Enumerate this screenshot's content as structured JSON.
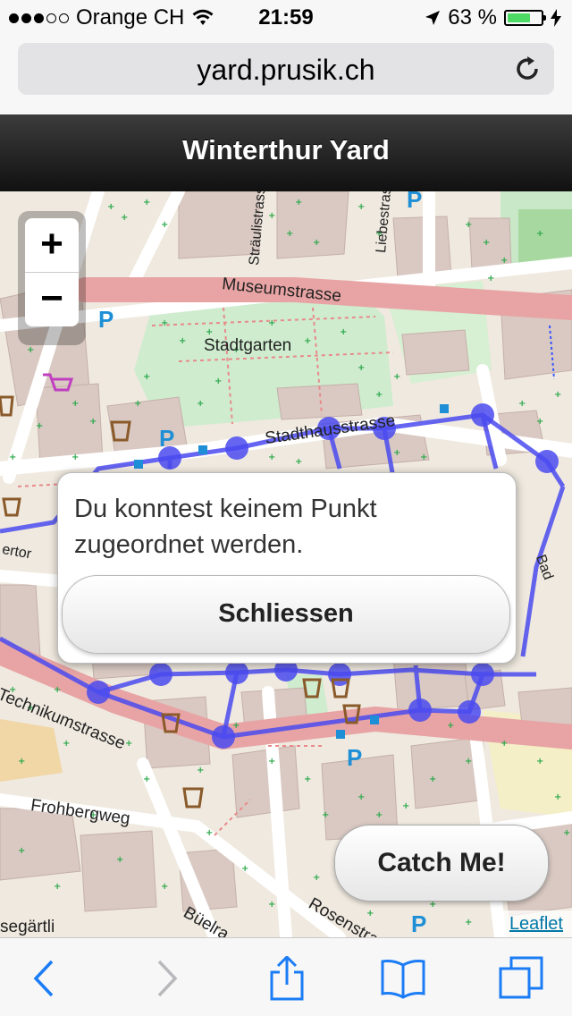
{
  "status_bar": {
    "carrier": "Orange CH",
    "time": "21:59",
    "battery_percent": "63 %",
    "battery_level": 0.63
  },
  "browser": {
    "url": "yard.prusik.ch"
  },
  "page": {
    "title": "Winterthur Yard"
  },
  "map": {
    "zoom_in_label": "+",
    "zoom_out_label": "−",
    "labels": {
      "museumstrasse": "Museumstrasse",
      "stadtgarten": "Stadtgarten",
      "stadthausstrasse": "Stadthausstrasse",
      "technikumstrasse": "Technikumstrasse",
      "frohbergweg": "Frohbergweg",
      "rosenstrasse": "Rosenstrasse",
      "bueelrain": "Büelra",
      "stauffacher": "Stadtha",
      "liebestrasse": "Liebestrasse",
      "strauli": "Sträulistrasse",
      "segaertli": "segärtli",
      "bad": "Bad",
      "ertor": "ertor"
    },
    "attribution": "Leaflet"
  },
  "popup": {
    "message": "Du konntest keinem Punkt zugeordnet werden.",
    "button_label": "Schliessen"
  },
  "catch_button_label": "Catch Me!",
  "icons": [
    "wifi-icon",
    "location-arrow-icon",
    "charging-bolt-icon",
    "reload-icon",
    "back-icon",
    "forward-icon",
    "share-icon",
    "bookmarks-icon",
    "tabs-icon"
  ],
  "colors": {
    "route": "#4b4bf0",
    "main_road": "#e8a4a4",
    "park": "#cfeccf",
    "building": "#d9c9c2"
  }
}
